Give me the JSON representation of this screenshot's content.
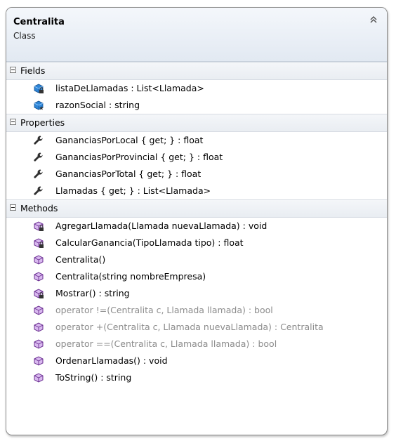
{
  "class": {
    "name": "Centralita",
    "stereotype": "Class"
  },
  "compartments": {
    "fields": {
      "title": "Fields",
      "items": [
        {
          "text": "listaDeLlamadas : List<Llamada>",
          "icon": "private-field-icon"
        },
        {
          "text": "razonSocial : string",
          "icon": "protected-field-icon"
        }
      ]
    },
    "properties": {
      "title": "Properties",
      "items": [
        {
          "text": "GananciasPorLocal { get; } : float",
          "icon": "property-wrench-icon"
        },
        {
          "text": "GananciasPorProvincial { get; } : float",
          "icon": "property-wrench-icon"
        },
        {
          "text": "GananciasPorTotal { get; } : float",
          "icon": "property-wrench-icon"
        },
        {
          "text": "Llamadas { get; } : List<Llamada>",
          "icon": "property-wrench-icon"
        }
      ]
    },
    "methods": {
      "title": "Methods",
      "items": [
        {
          "text": "AgregarLlamada(Llamada nuevaLlamada) : void",
          "icon": "private-method-icon"
        },
        {
          "text": "CalcularGanancia(TipoLlamada tipo) : float",
          "icon": "private-method-icon"
        },
        {
          "text": "Centralita()",
          "icon": "method-icon"
        },
        {
          "text": "Centralita(string nombreEmpresa)",
          "icon": "method-icon"
        },
        {
          "text": "Mostrar() : string",
          "icon": "private-method-icon"
        },
        {
          "text": "operator !=(Centralita c, Llamada llamada) : bool",
          "icon": "method-icon"
        },
        {
          "text": "operator +(Centralita c, Llamada nuevaLlamada) : Centralita",
          "icon": "method-icon"
        },
        {
          "text": "operator ==(Centralita c, Llamada llamada) : bool",
          "icon": "method-icon"
        },
        {
          "text": "OrdenarLlamadas() : void",
          "icon": "method-icon"
        },
        {
          "text": "ToString() : string",
          "icon": "method-icon"
        }
      ]
    }
  },
  "colors": {
    "field_icon": "#1f74c9",
    "method_icon": "#7b3fa0",
    "wrench_icon": "#3a3a3a",
    "inherited_text": "#8c8c8c"
  }
}
